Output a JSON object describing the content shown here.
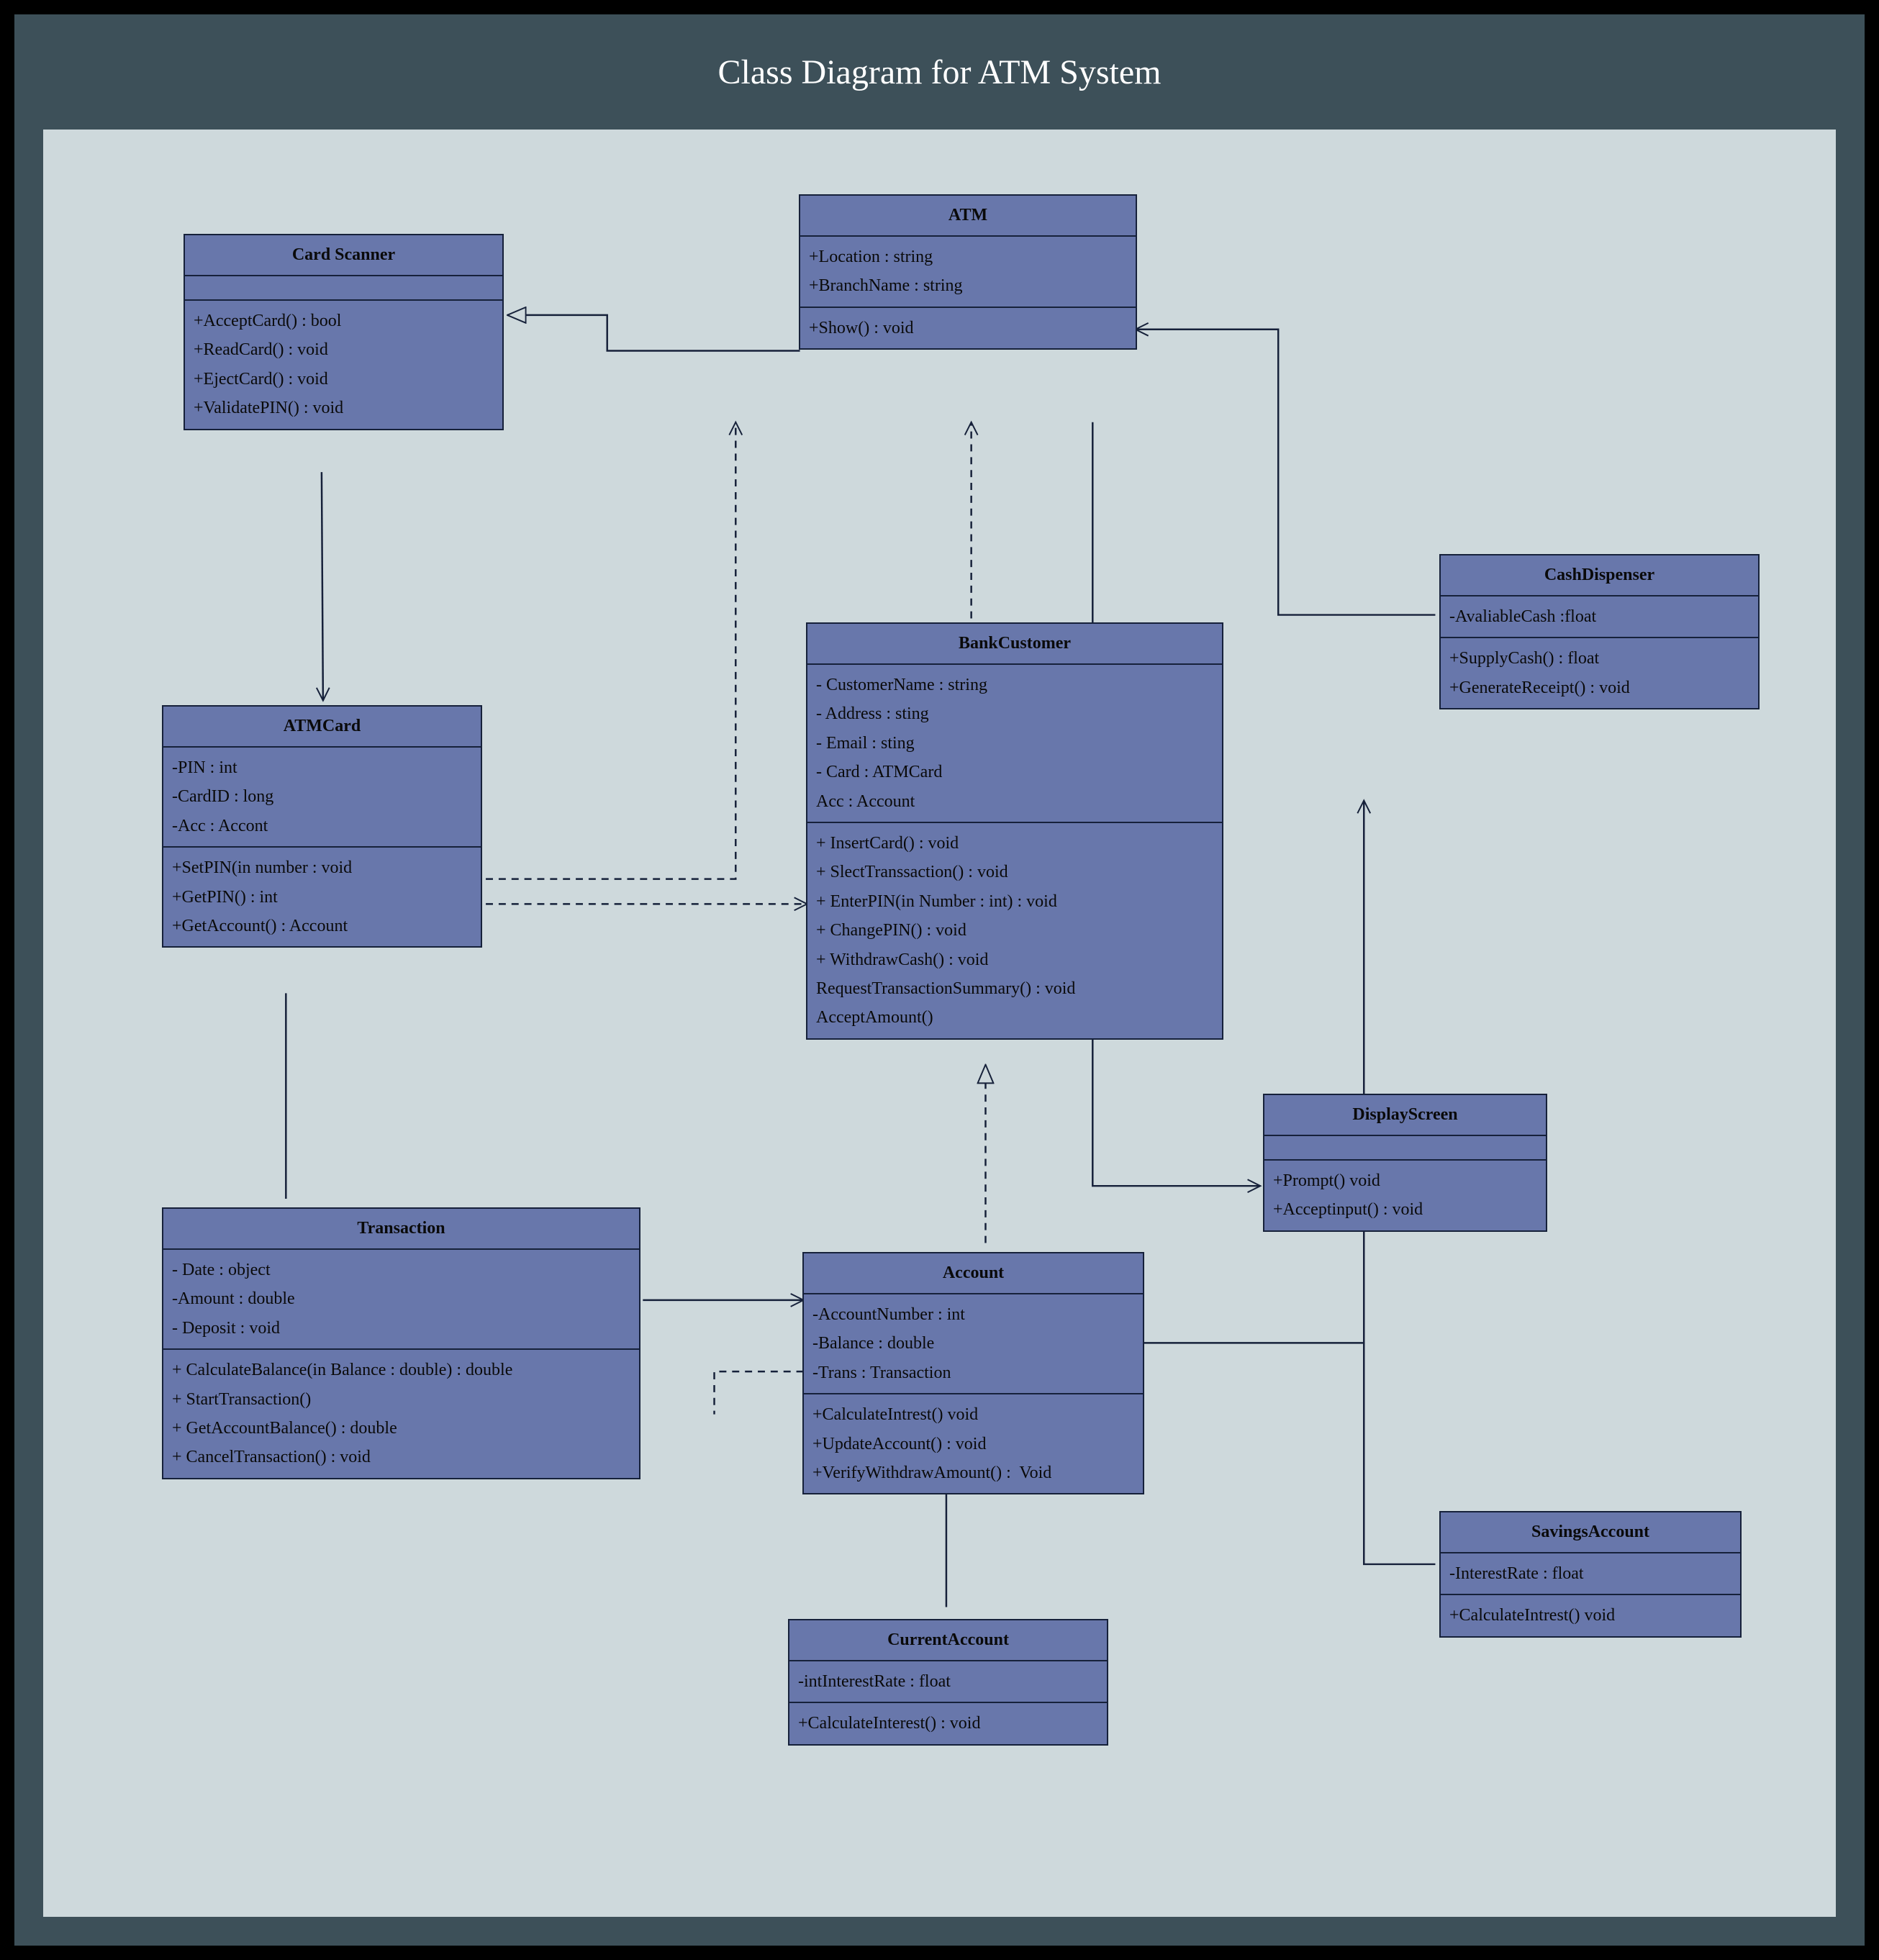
{
  "title": "Class Diagram for ATM System",
  "classes": {
    "cardScanner": {
      "name": "Card Scanner",
      "attrs": [],
      "ops": [
        "+AcceptCard() : bool",
        "+ReadCard() : void",
        "+EjectCard() : void",
        "+ValidatePIN() : void"
      ]
    },
    "atm": {
      "name": "ATM",
      "attrs": [
        "+Location : string",
        "+BranchName : string"
      ],
      "ops": [
        "+Show() : void"
      ]
    },
    "cashDispenser": {
      "name": "CashDispenser",
      "attrs": [
        "-AvaliableCash :float"
      ],
      "ops": [
        "+SupplyCash() : float",
        "+GenerateReceipt() : void"
      ]
    },
    "atmCard": {
      "name": "ATMCard",
      "attrs": [
        "-PIN : int",
        "-CardID : long",
        "-Acc : Accont"
      ],
      "ops": [
        "+SetPIN(in number : void",
        "+GetPIN() : int",
        "+GetAccount() : Account"
      ]
    },
    "bankCustomer": {
      "name": "BankCustomer",
      "attrs": [
        "- CustomerName : string",
        "- Address : sting",
        "- Email : sting",
        "- Card : ATMCard",
        "Acc : Account"
      ],
      "ops": [
        "+ InsertCard() : void",
        "+ SlectTranssaction() : void",
        "+ EnterPIN(in Number : int) : void",
        "+ ChangePIN() : void",
        "+ WithdrawCash() : void",
        "RequestTransactionSummary() : void",
        "AcceptAmount()"
      ]
    },
    "displayScreen": {
      "name": "DisplayScreen",
      "attrs": [],
      "ops": [
        "+Prompt() void",
        "+Acceptinput() : void"
      ]
    },
    "transaction": {
      "name": "Transaction",
      "attrs": [
        "- Date : object",
        "-Amount : double",
        "- Deposit : void"
      ],
      "ops": [
        "+ CalculateBalance(in Balance : double) : double",
        "+ StartTransaction()",
        "+ GetAccountBalance() : double",
        "+ CancelTransaction() : void"
      ]
    },
    "account": {
      "name": "Account",
      "attrs": [
        "-AccountNumber : int",
        "-Balance : double",
        "-Trans : Transaction"
      ],
      "ops": [
        "+CalculateIntrest() void",
        "+UpdateAccount() : void",
        "+VerifyWithdrawAmount() :  Void"
      ]
    },
    "currentAccount": {
      "name": "CurrentAccount",
      "attrs": [
        "-intInterestRate : float"
      ],
      "ops": [
        "+CalculateInterest() : void"
      ]
    },
    "savingsAccount": {
      "name": "SavingsAccount",
      "attrs": [
        "-InterestRate : float"
      ],
      "ops": [
        "+CalculateIntrest() void"
      ]
    }
  }
}
